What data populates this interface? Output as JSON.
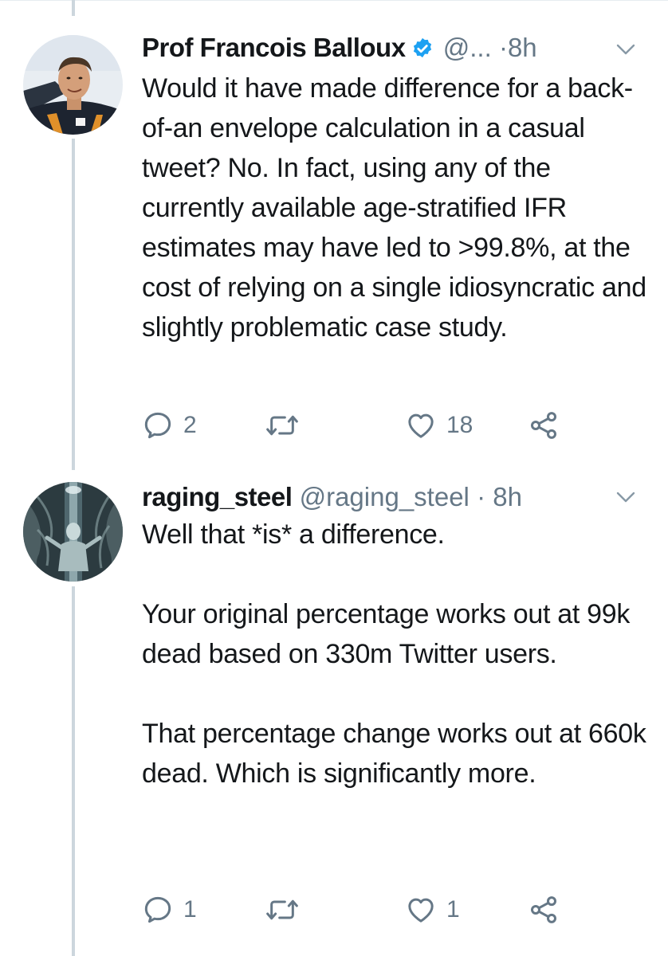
{
  "tweets": [
    {
      "display_name": "Prof Francois Balloux",
      "verified": true,
      "handle": "@...",
      "separator": "·",
      "time": "8h",
      "text": "Would it have made difference for a back-of-an envelope calculation in a casual tweet? No. In fact, using any of the currently available age-stratified IFR estimates may have led to >99.8%, at the cost of relying on a single idiosyncratic and slightly problematic case study.",
      "reply_count": "2",
      "retweet_count": "",
      "like_count": "18",
      "icons": {
        "reply": "reply-icon",
        "retweet": "retweet-icon",
        "like": "heart-icon",
        "share": "share-icon",
        "menu": "chevron-down-icon",
        "verified": "verified-badge-icon"
      }
    },
    {
      "display_name": "raging_steel",
      "verified": false,
      "handle": "@raging_steel",
      "separator": "·",
      "time": "8h",
      "text": "Well that *is* a difference.\n\nYour original percentage works out at 99k dead based on 330m Twitter users.\n\nThat percentage change works out at 660k dead. Which is significantly more.",
      "reply_count": "1",
      "retweet_count": "",
      "like_count": "1",
      "icons": {
        "reply": "reply-icon",
        "retweet": "retweet-icon",
        "like": "heart-icon",
        "share": "share-icon",
        "menu": "chevron-down-icon"
      }
    }
  ],
  "colors": {
    "text": "#14171a",
    "secondary": "#657786",
    "verified_blue": "#1da1f2",
    "thread_line": "#ccd6dd",
    "background": "#ffffff"
  }
}
